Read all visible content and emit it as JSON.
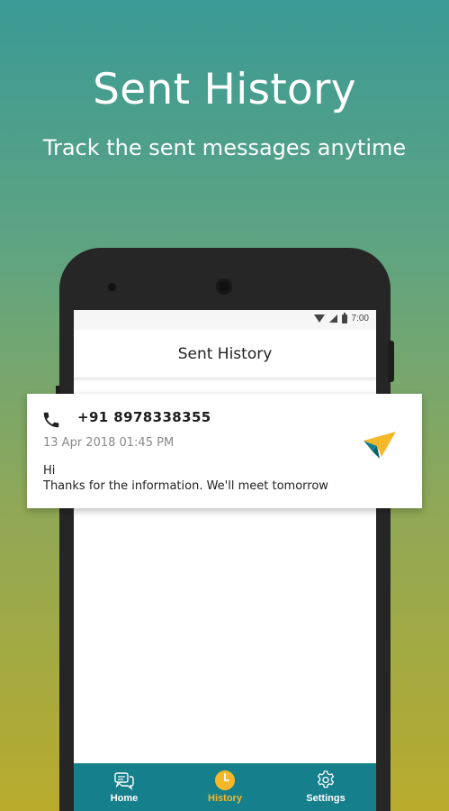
{
  "promo": {
    "title": "Sent History",
    "subtitle": "Track the sent messages anytime"
  },
  "device": {
    "status_time": "7:00"
  },
  "appbar": {
    "title": "Sent History"
  },
  "message": {
    "number": "+91 8978338355",
    "datetime": "13 Apr 2018 01:45 PM",
    "line1": "Hi",
    "line2": "Thanks for the information. We'll meet tomorrow",
    "icons": [
      "phone-icon",
      "sent-plane-icon"
    ]
  },
  "bottom_nav": {
    "items": [
      {
        "label": "Home",
        "icon": "chat-bubbles-icon",
        "active": false
      },
      {
        "label": "History",
        "icon": "clock-icon",
        "active": true
      },
      {
        "label": "Settings",
        "icon": "gear-icon",
        "active": false
      }
    ]
  },
  "colors": {
    "nav_bg": "#167f8c",
    "active_accent": "#f5b82a",
    "gradient_top": "#3a9a95",
    "gradient_bottom": "#b8ab2c"
  }
}
